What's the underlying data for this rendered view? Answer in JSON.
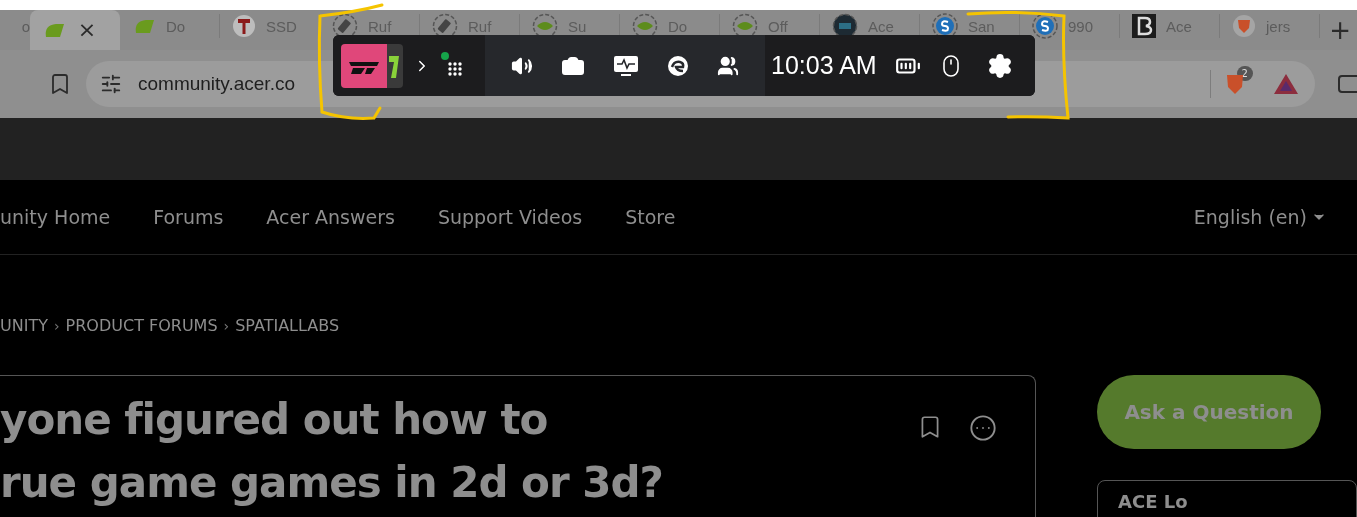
{
  "tabs": [
    {
      "kind": "generic",
      "label": "o",
      "selected": false
    },
    {
      "kind": "acer",
      "close": "×",
      "selected": true
    },
    {
      "kind": "acer",
      "label": "Do",
      "selected": false
    },
    {
      "kind": "tool",
      "label": "SSD",
      "selected": false
    },
    {
      "kind": "usb",
      "label": "Ruf",
      "selected": false
    },
    {
      "kind": "usb",
      "label": "Ruf",
      "selected": false
    },
    {
      "kind": "nvidia",
      "label": "Su",
      "selected": false
    },
    {
      "kind": "nvidia",
      "label": "Do",
      "selected": false
    },
    {
      "kind": "nvidia",
      "label": "Off",
      "selected": false
    },
    {
      "kind": "pc",
      "label": "Ace",
      "selected": false
    },
    {
      "kind": "s",
      "label": "San",
      "selected": false
    },
    {
      "kind": "s",
      "label": "990",
      "selected": false
    },
    {
      "kind": "b",
      "label": "Ace",
      "selected": false
    },
    {
      "kind": "brave",
      "label": "jers",
      "selected": false
    }
  ],
  "new_tab": "+",
  "address_bar": {
    "url": "community.acer.co",
    "extension_badge": "2"
  },
  "game_bar": {
    "notification": true,
    "time": "10:03 AM"
  },
  "nav": {
    "items": [
      "unity Home",
      "Forums",
      "Acer Answers",
      "Support Videos",
      "Store"
    ],
    "language": "English (en)"
  },
  "breadcrumb": {
    "items": [
      "UNITY",
      "PRODUCT FORUMS",
      "SPATIALLABS"
    ],
    "separator": "›"
  },
  "post": {
    "title_lines": [
      "yone figured out how to",
      "rue game games in 2d or 3d?"
    ]
  },
  "sidebar": {
    "button": "Ask a Question",
    "card_title": "ACE Lo"
  }
}
